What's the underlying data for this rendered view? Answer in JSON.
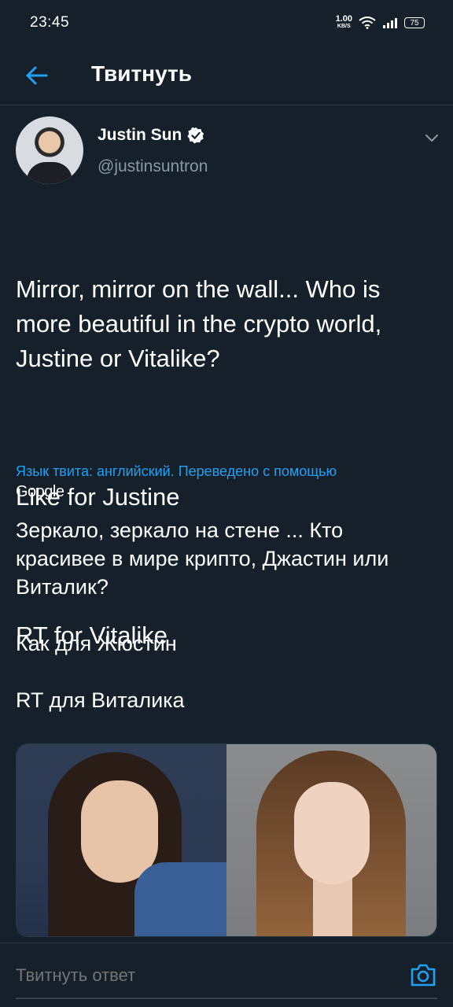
{
  "status_bar": {
    "time": "23:45",
    "net_speed_value": "1.00",
    "net_speed_unit": "KB/S",
    "battery": "75"
  },
  "header": {
    "title": "Твитнуть"
  },
  "author": {
    "name": "Justin Sun",
    "handle": "@justinsuntron"
  },
  "tweet": {
    "line1": "Mirror, mirror on the wall... Who is more beautiful in the crypto world, Justine or Vitalike?",
    "line2": "Like for Justine",
    "line3": "RT for Vitalike"
  },
  "translation_note": "Язык твита: английский. Переведено с помощью",
  "translation_provider": "Google",
  "translation": {
    "line1": "Зеркало, зеркало на стене ... Кто красивее в мире крипто, Джастин или Виталик?",
    "line2": " Как для Жюстин",
    "line3": " RT для Виталика"
  },
  "reply": {
    "placeholder": "Твитнуть ответ"
  },
  "colors": {
    "background": "#15202b",
    "accent": "#1da1f2",
    "secondary_text": "#8899a6"
  },
  "icons": {
    "back": "arrow-left-icon",
    "verified": "verified-badge-icon",
    "caret": "chevron-down-icon",
    "camera": "camera-icon"
  }
}
